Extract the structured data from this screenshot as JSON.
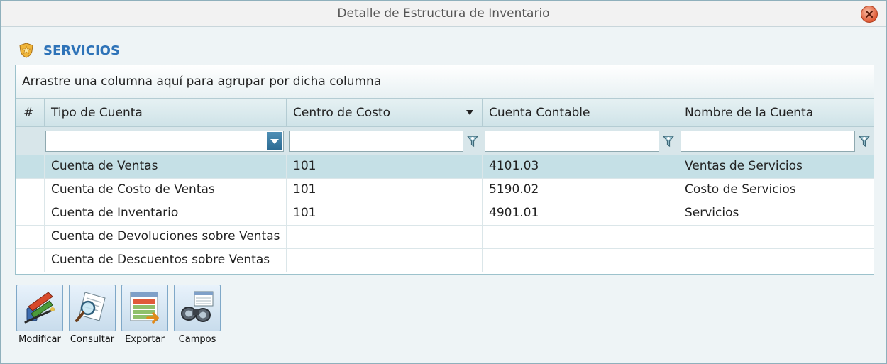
{
  "window": {
    "title": "Detalle de Estructura de Inventario"
  },
  "section": {
    "title": "SERVICIOS"
  },
  "grid": {
    "group_hint": "Arrastre una columna aquí para agrupar por dicha columna",
    "columns": [
      "#",
      "Tipo de Cuenta",
      "Centro de Costo",
      "Cuenta Contable",
      "Nombre de la Cuenta"
    ],
    "rows": [
      {
        "tipo": "Cuenta de Ventas",
        "centro": "101",
        "cuenta": "4101.03",
        "nombre": "Ventas de Servicios"
      },
      {
        "tipo": "Cuenta de Costo de Ventas",
        "centro": "101",
        "cuenta": "5190.02",
        "nombre": "Costo de Servicios"
      },
      {
        "tipo": "Cuenta de Inventario",
        "centro": "101",
        "cuenta": "4901.01",
        "nombre": "Servicios"
      },
      {
        "tipo": "Cuenta de Devoluciones sobre Ventas",
        "centro": "",
        "cuenta": "",
        "nombre": ""
      },
      {
        "tipo": "Cuenta de Descuentos sobre Ventas",
        "centro": "",
        "cuenta": "",
        "nombre": ""
      }
    ]
  },
  "toolbar": {
    "modificar": "Modificar",
    "consultar": "Consultar",
    "exportar": "Exportar",
    "campos": "Campos"
  },
  "icons": {
    "close": "close-icon",
    "section": "shield-icon",
    "filter": "funnel-icon",
    "modificar": "pen-tools-icon",
    "consultar": "magnifier-document-icon",
    "exportar": "spreadsheet-export-icon",
    "campos": "binoculars-icon"
  },
  "colors": {
    "accent": "#2e73b8",
    "selected_row": "#c5e0e6",
    "header": "#d8e6ea"
  }
}
